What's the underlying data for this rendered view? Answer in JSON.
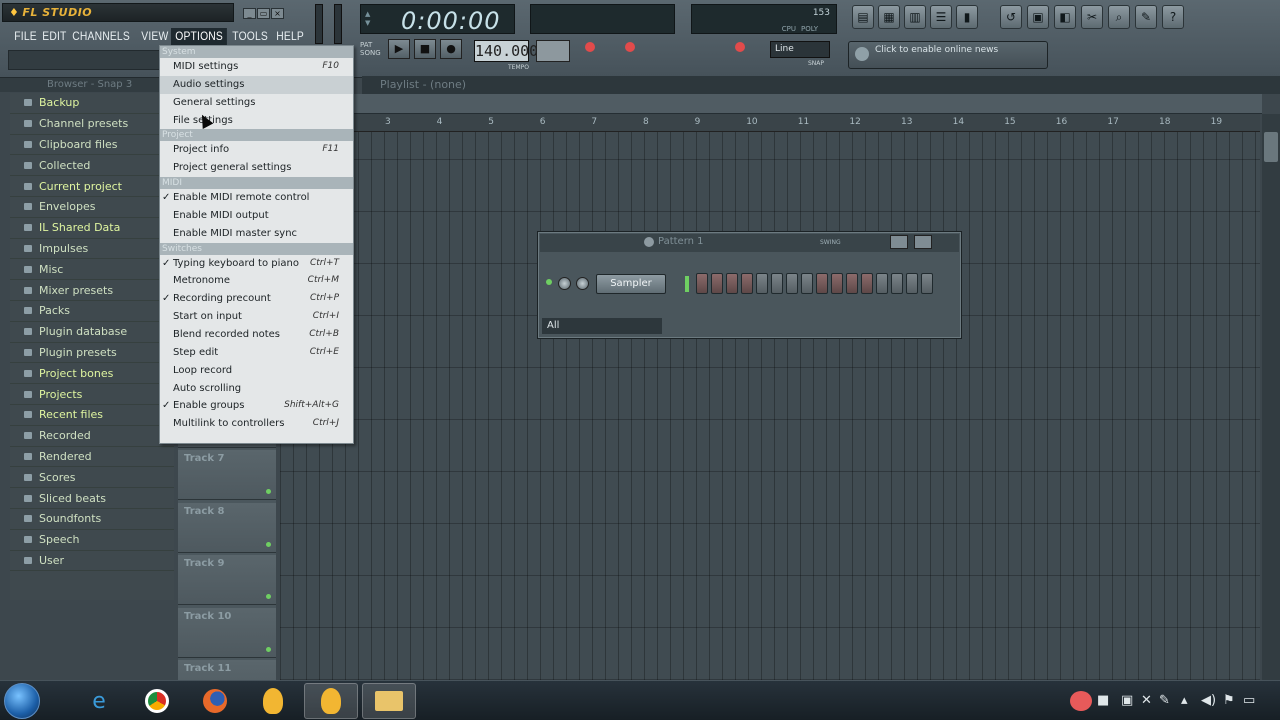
{
  "app": {
    "logo": "FL STUDIO",
    "window_buttons": [
      "_",
      "▭",
      "×"
    ]
  },
  "menubar": [
    "FILE",
    "EDIT",
    "CHANNELS",
    "VIEW",
    "OPTIONS",
    "TOOLS",
    "HELP"
  ],
  "transport": {
    "time": "0:00:00",
    "tempo": "140.000",
    "tempo_label": "TEMPO",
    "pat_label": "PAT",
    "song_label": "SONG",
    "snap_value": "Line",
    "snap_label": "SNAP",
    "news_text": "Click to enable online news",
    "cpu_number": "153",
    "cpu_labels": [
      "CPU",
      "POLY"
    ]
  },
  "browser": {
    "header": "Browser - Snap 3",
    "items": [
      {
        "label": "Backup",
        "bright": true
      },
      {
        "label": "Channel presets",
        "bright": false
      },
      {
        "label": "Clipboard files",
        "bright": false
      },
      {
        "label": "Collected",
        "bright": false
      },
      {
        "label": "Current project",
        "bright": true
      },
      {
        "label": "Envelopes",
        "bright": false
      },
      {
        "label": "IL Shared Data",
        "bright": true
      },
      {
        "label": "Impulses",
        "bright": false
      },
      {
        "label": "Misc",
        "bright": false
      },
      {
        "label": "Mixer presets",
        "bright": false
      },
      {
        "label": "Packs",
        "bright": false
      },
      {
        "label": "Plugin database",
        "bright": false
      },
      {
        "label": "Plugin presets",
        "bright": false
      },
      {
        "label": "Project bones",
        "bright": true
      },
      {
        "label": "Projects",
        "bright": true
      },
      {
        "label": "Recent files",
        "bright": true
      },
      {
        "label": "Recorded",
        "bright": false
      },
      {
        "label": "Rendered",
        "bright": false
      },
      {
        "label": "Scores",
        "bright": false
      },
      {
        "label": "Sliced beats",
        "bright": false
      },
      {
        "label": "Soundfonts",
        "bright": false
      },
      {
        "label": "Speech",
        "bright": false
      },
      {
        "label": "User",
        "bright": false
      }
    ]
  },
  "playlist": {
    "title": "Playlist - (none)",
    "ruler": [
      "3",
      "4",
      "5",
      "6",
      "7",
      "8",
      "9",
      "10",
      "11",
      "12",
      "13",
      "14",
      "15",
      "16",
      "17",
      "18",
      "19"
    ],
    "tracks": [
      "Track 7",
      "Track 8",
      "Track 9",
      "Track 10",
      "Track 11"
    ]
  },
  "step_sequencer": {
    "title": "Pattern 1",
    "swing_label": "SWING",
    "channel": "Sampler",
    "filter": "All",
    "steps": 16
  },
  "options_menu": {
    "sections": [
      {
        "header": "System",
        "items": [
          {
            "label": "MIDI settings",
            "shortcut": "F10",
            "checked": false,
            "highlighted": false
          },
          {
            "label": "Audio settings",
            "shortcut": "",
            "checked": false,
            "highlighted": true
          },
          {
            "label": "General settings",
            "shortcut": "",
            "checked": false,
            "highlighted": false
          },
          {
            "label": "File settings",
            "shortcut": "",
            "checked": false,
            "highlighted": false
          }
        ]
      },
      {
        "header": "Project",
        "items": [
          {
            "label": "Project info",
            "shortcut": "F11",
            "checked": false,
            "highlighted": false
          },
          {
            "label": "Project general settings",
            "shortcut": "",
            "checked": false,
            "highlighted": false
          }
        ]
      },
      {
        "header": "MIDI",
        "items": [
          {
            "label": "Enable MIDI remote control",
            "shortcut": "",
            "checked": true,
            "highlighted": false
          },
          {
            "label": "Enable MIDI output",
            "shortcut": "",
            "checked": false,
            "highlighted": false
          },
          {
            "label": "Enable MIDI master sync",
            "shortcut": "",
            "checked": false,
            "highlighted": false
          }
        ]
      },
      {
        "header": "Switches",
        "items": [
          {
            "label": "Typing keyboard to piano",
            "shortcut": "Ctrl+T",
            "checked": true,
            "highlighted": false
          },
          {
            "label": "Metronome",
            "shortcut": "Ctrl+M",
            "checked": false,
            "highlighted": false
          },
          {
            "label": "Recording precount",
            "shortcut": "Ctrl+P",
            "checked": true,
            "highlighted": false
          },
          {
            "label": "Start on input",
            "shortcut": "Ctrl+I",
            "checked": false,
            "highlighted": false
          },
          {
            "label": "Blend recorded notes",
            "shortcut": "Ctrl+B",
            "checked": false,
            "highlighted": false
          },
          {
            "label": "Step edit",
            "shortcut": "Ctrl+E",
            "checked": false,
            "highlighted": false
          },
          {
            "label": "Loop record",
            "shortcut": "",
            "checked": false,
            "highlighted": false
          },
          {
            "label": "Auto scrolling",
            "shortcut": "",
            "checked": false,
            "highlighted": false
          },
          {
            "label": "Enable groups",
            "shortcut": "Shift+Alt+G",
            "checked": true,
            "highlighted": false
          },
          {
            "label": "Multilink to controllers",
            "shortcut": "Ctrl+J",
            "checked": false,
            "highlighted": false
          }
        ]
      }
    ]
  },
  "taskbar": {
    "apps": [
      "internet-explorer-icon",
      "chrome-icon",
      "firefox-icon",
      "fl-studio-icon",
      "fl-studio-active-icon",
      "file-explorer-icon"
    ]
  }
}
